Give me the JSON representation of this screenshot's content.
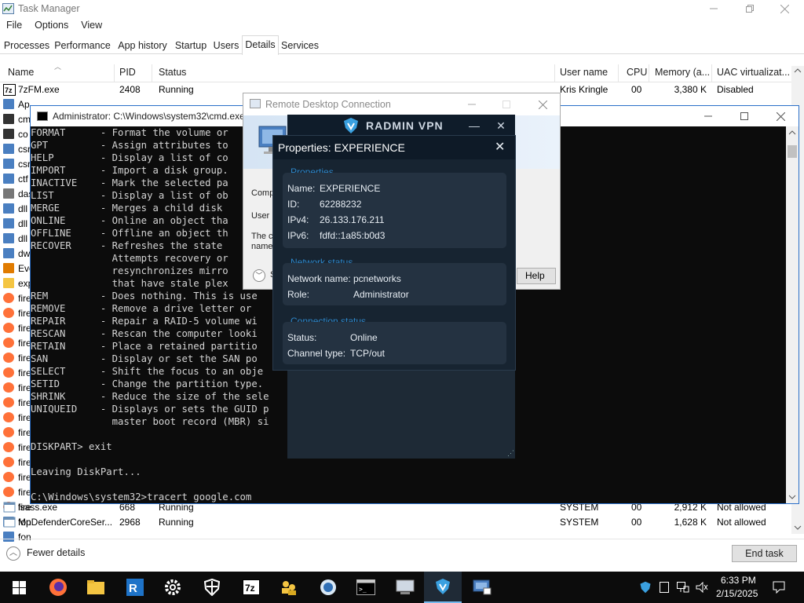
{
  "task_manager": {
    "title": "Task Manager",
    "menu": [
      "File",
      "Options",
      "View"
    ],
    "tabs": [
      "Processes",
      "Performance",
      "App history",
      "Startup",
      "Users",
      "Details",
      "Services"
    ],
    "active_tab": "Details",
    "columns": [
      "Name",
      "PID",
      "Status",
      "User name",
      "CPU",
      "Memory (a...",
      "UAC virtualizat..."
    ],
    "rows": [
      {
        "name": "7zFM.exe",
        "pid": "2408",
        "status": "Running",
        "user": "Kris Kringle",
        "cpu": "00",
        "memory": "3,380 K",
        "uac": "Disabled"
      },
      {
        "name": "lsass.exe",
        "pid": "668",
        "status": "Running",
        "user": "SYSTEM",
        "cpu": "00",
        "memory": "2,912 K",
        "uac": "Not allowed"
      },
      {
        "name": "MpDefenderCoreSer...",
        "pid": "2968",
        "status": "Running",
        "user": "SYSTEM",
        "cpu": "00",
        "memory": "1,628 K",
        "uac": "Not allowed"
      }
    ],
    "partial_names": [
      "Ap",
      "cm",
      "co",
      "csr",
      "csr",
      "ctf",
      "das",
      "dll",
      "dll",
      "dll",
      "dw",
      "Eve",
      "exp",
      "fire",
      "fire",
      "fire",
      "fire",
      "fire",
      "fire",
      "fire",
      "fire",
      "fire",
      "fire",
      "fire",
      "fire",
      "fire",
      "fire",
      "fire",
      "fon",
      "fon"
    ],
    "fewer_details": "Fewer details",
    "end_task": "End task"
  },
  "cmd": {
    "title": "Administrator: C:\\Windows\\system32\\cmd.exe",
    "lines": [
      "FORMAT      - Format the volume or",
      "GPT         - Assign attributes to",
      "HELP        - Display a list of co",
      "IMPORT      - Import a disk group.",
      "INACTIVE    - Mark the selected pa",
      "LIST        - Display a list of ob",
      "MERGE       - Merges a child disk ",
      "ONLINE      - Online an object tha",
      "OFFLINE     - Offline an object th",
      "RECOVER     - Refreshes the state ",
      "              Attempts recovery or",
      "              resynchronizes mirro",
      "              that have stale plex",
      "REM         - Does nothing. This is use",
      "REMOVE      - Remove a drive letter or ",
      "REPAIR      - Repair a RAID-5 volume wi",
      "RESCAN      - Rescan the computer looki",
      "RETAIN      - Place a retained partitio",
      "SAN         - Display or set the SAN po",
      "SELECT      - Shift the focus to an obje",
      "SETID       - Change the partition type.",
      "SHRINK      - Reduce the size of the sele",
      "UNIQUEID    - Displays or sets the GUID p",
      "              master boot record (MBR) si",
      "",
      "DISKPART> exit",
      "",
      "Leaving DiskPart...",
      "",
      "C:\\Windows\\system32>tracert google.com"
    ]
  },
  "rdc": {
    "title": "Remote Desktop Connection",
    "text_comp": "Compu",
    "text_user": "User n",
    "text_c": "The c",
    "text_name": "name.",
    "text_s": "S",
    "help_label": "Help"
  },
  "radmin": {
    "brand": "RADMIN VPN",
    "min_glyph": "—",
    "close_glyph": "✕"
  },
  "properties": {
    "title": "Properties: EXPERIENCE",
    "close_glyph": "✕",
    "section_properties": "Properties",
    "name_label": "Name:",
    "name_value": "EXPERIENCE",
    "id_label": "ID:",
    "id_value": "62288232",
    "ipv4_label": "IPv4:",
    "ipv4_value": "26.133.176.211",
    "ipv6_label": "IPv6:",
    "ipv6_value": "fdfd::1a85:b0d3",
    "section_network": "Network status",
    "network_name_label": "Network name:",
    "network_name_value": "pcnetworks",
    "role_label": "Role:",
    "role_value": "Administrator",
    "section_connection": "Connection status",
    "status_label": "Status:",
    "status_value": "Online",
    "channel_label": "Channel type:",
    "channel_value": "TCP/out"
  },
  "taskbar": {
    "time": "6:33 PM",
    "date": "2/15/2025"
  },
  "colors": {
    "radmin_bg": "#1e2a36",
    "radmin_accent": "#2e86c8",
    "cmd_bg": "#0c0c0c"
  }
}
